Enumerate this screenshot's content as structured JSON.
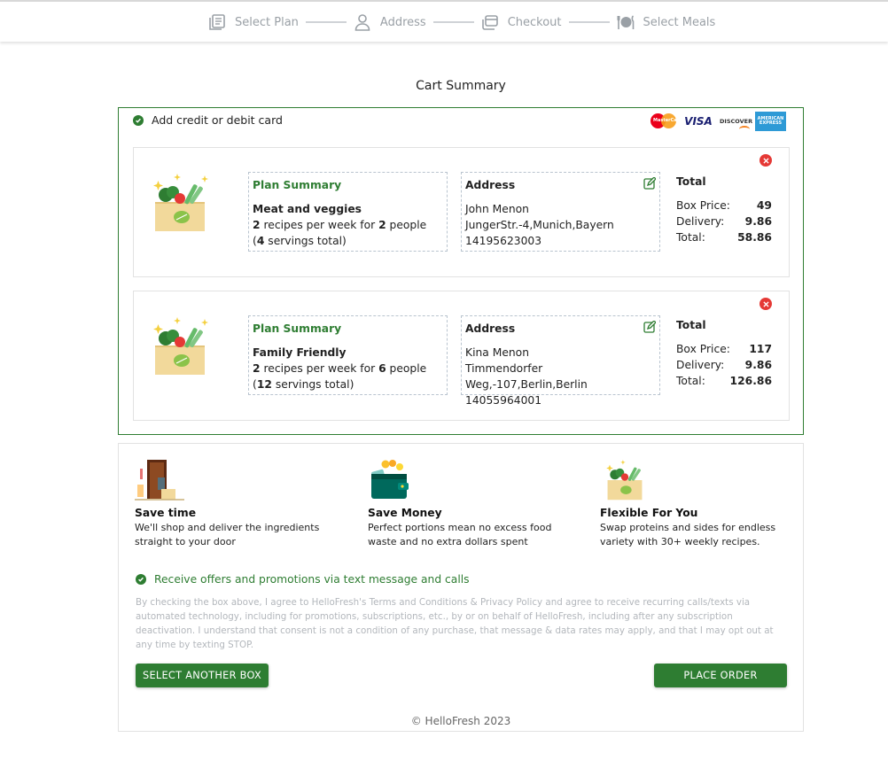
{
  "stepper": {
    "steps": [
      {
        "label": "Select Plan",
        "icon": "plan-icon"
      },
      {
        "label": "Address",
        "icon": "user-icon"
      },
      {
        "label": "Checkout",
        "icon": "checkout-icon"
      },
      {
        "label": "Select Meals",
        "icon": "meals-icon"
      }
    ]
  },
  "cart": {
    "title": "Cart Summary",
    "add_card_label": "Add credit or debit card",
    "card_logos": {
      "mastercard": "MasterCard",
      "visa": "VISA",
      "discover": "DISCOVER",
      "amex": "AMERICAN EXPRESS"
    },
    "orders": [
      {
        "plan_heading": "Plan Summary",
        "plan_name": "Meat and veggies",
        "recipes": "2",
        "recipes_text": " recipes per week for ",
        "people": "2",
        "people_text": " people",
        "servings_open": "(",
        "servings": "4",
        "servings_text": " servings total)",
        "address_heading": "Address",
        "name": "John Menon",
        "street": "JungerStr.-4,Munich,Bayern",
        "phone": "14195623003",
        "total_heading": "Total",
        "box_price_label": "Box Price:",
        "box_price": "49",
        "delivery_label": "Delivery:",
        "delivery": "9.86",
        "total_label": "Total:",
        "total": "58.86"
      },
      {
        "plan_heading": "Plan Summary",
        "plan_name": "Family Friendly",
        "recipes": "2",
        "recipes_text": " recipes per week for ",
        "people": "6",
        "people_text": " people",
        "servings_open": "(",
        "servings": "12",
        "servings_text": " servings total)",
        "address_heading": "Address",
        "name": "Kina Menon",
        "street": "Timmendorfer Weg,-107,Berlin,Berlin",
        "phone": "14055964001",
        "total_heading": "Total",
        "box_price_label": "Box Price:",
        "box_price": "117",
        "delivery_label": "Delivery:",
        "delivery": "9.86",
        "total_label": "Total:",
        "total": "126.86"
      }
    ]
  },
  "features": [
    {
      "title": "Save time",
      "desc": "We'll shop and deliver the ingredients straight to your door",
      "icon": "door-delivery-icon"
    },
    {
      "title": "Save Money",
      "desc": "Perfect portions mean no excess food waste and no extra dollars spent",
      "icon": "wallet-icon"
    },
    {
      "title": "Flexible For You",
      "desc": "Swap proteins and sides for endless variety with 30+ weekly recipes.",
      "icon": "meal-box-icon"
    }
  ],
  "promo_label": "Receive offers and promotions via text message and calls",
  "legal_text": "By checking the box above, I agree to HelloFresh's Terms and Conditions & Privacy Policy and agree to receive recurring calls/texts via automated technology, including for promotions, subscriptions, etc., by or on behalf of HelloFresh, including after any subscription deactivation. I understand that consent is not a condition of any purchase, that message & data rates may apply, and that I may opt out at any time by texting STOP.",
  "buttons": {
    "select_another": "SELECT ANOTHER BOX",
    "place_order": "PLACE ORDER"
  },
  "footer": "© HelloFresh 2023",
  "colors": {
    "brand_green": "#2e7d32",
    "remove_red": "#e53935",
    "step_gray": "#9aa0a6"
  }
}
